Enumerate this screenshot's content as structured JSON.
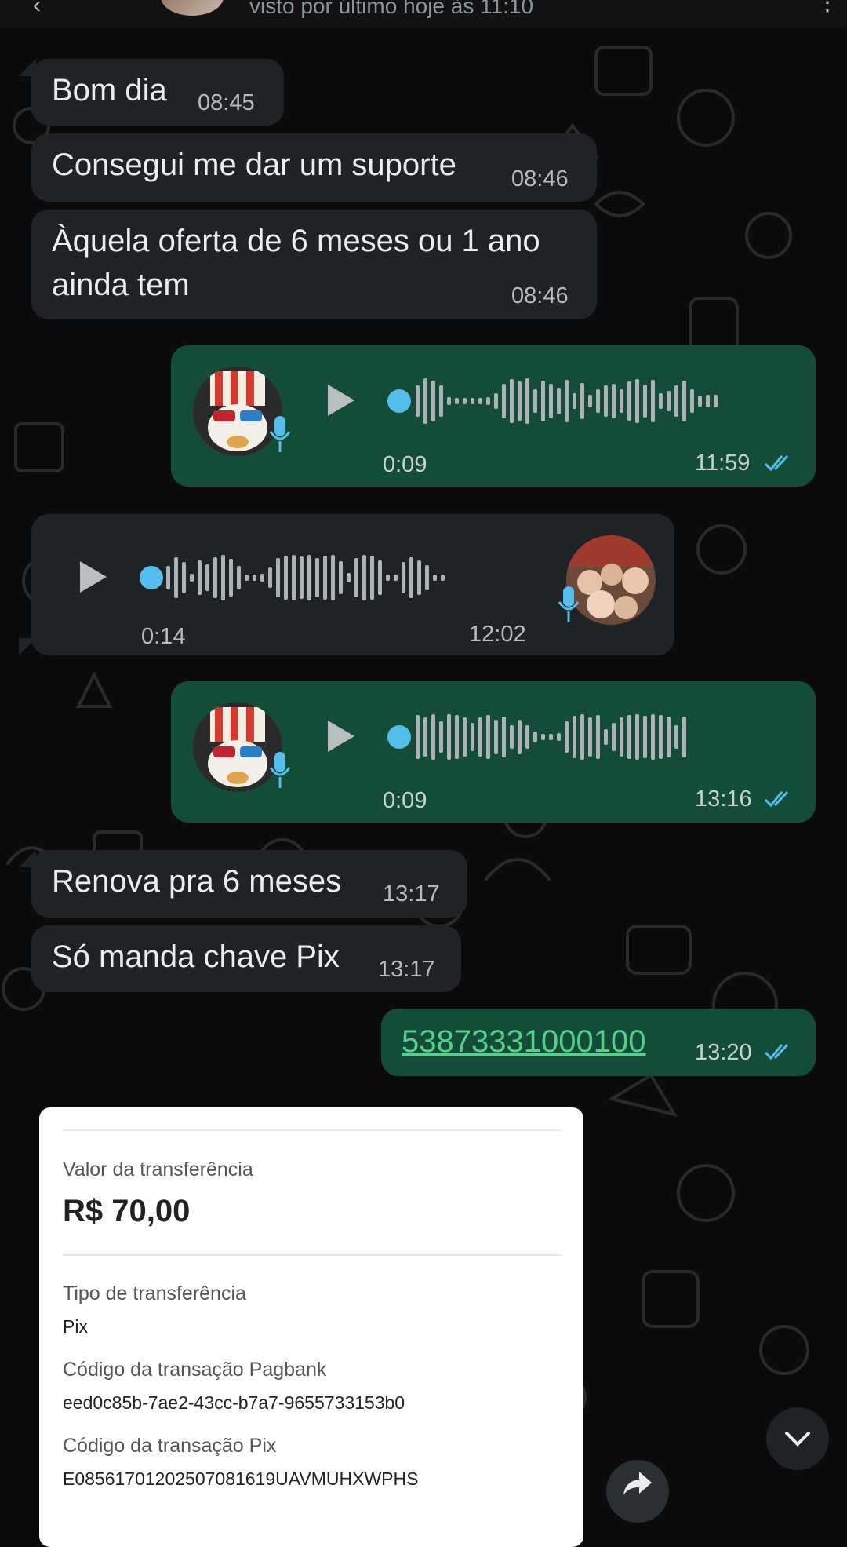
{
  "header": {
    "status_text": "visto por último hoje às 11:10"
  },
  "messages": [
    {
      "type": "text",
      "direction": "in",
      "text": "Bom dia",
      "time": "08:45"
    },
    {
      "type": "text",
      "direction": "in",
      "text": "Consegui me dar um suporte",
      "time": "08:46"
    },
    {
      "type": "text",
      "direction": "in",
      "text_line1": "Àquela oferta de 6 meses ou 1 ano",
      "text_line2": "ainda tem",
      "time": "08:46"
    },
    {
      "type": "audio",
      "direction": "out",
      "duration": "0:09",
      "time": "11:59",
      "status": "read"
    },
    {
      "type": "audio",
      "direction": "in",
      "duration": "0:14",
      "time": "12:02"
    },
    {
      "type": "audio",
      "direction": "out",
      "duration": "0:09",
      "time": "13:16",
      "status": "read"
    },
    {
      "type": "text",
      "direction": "in",
      "text": "Renova pra 6 meses",
      "time": "13:17"
    },
    {
      "type": "text",
      "direction": "in",
      "text": "Só manda chave Pix",
      "time": "13:17"
    },
    {
      "type": "link",
      "direction": "out",
      "text": "53873331000100",
      "time": "13:20",
      "status": "read"
    }
  ],
  "receipt": {
    "amount_label": "Valor da transferência",
    "amount": "R$ 70,00",
    "type_label": "Tipo de transferência",
    "type_value": "Pix",
    "pagbank_label": "Código da transação Pagbank",
    "pagbank_value": "eed0c85b-7ae2-43cc-b7a7-9655733153b0",
    "pix_label": "Código da transação Pix",
    "pix_value": "E08561701202507081619UAVMUHXWPHS"
  },
  "icons": {
    "scroll_down": "chevron-down-icon",
    "forward": "forward-arrow-icon",
    "play": "play-icon",
    "mic": "mic-icon",
    "read_receipt": "double-check-icon"
  },
  "colors": {
    "background": "#0b0b0b",
    "incoming_bubble": "#1f2326",
    "outgoing_bubble": "#144d37",
    "read_tick": "#53bdeb",
    "link": "#53d08c"
  }
}
